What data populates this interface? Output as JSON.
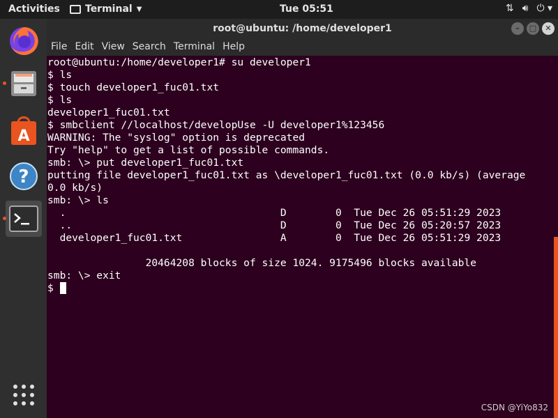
{
  "top_panel": {
    "activities": "Activities",
    "app_name": "Terminal",
    "clock": "Tue 05:51"
  },
  "window": {
    "title": "root@ubuntu: /home/developer1",
    "menu": [
      "File",
      "Edit",
      "View",
      "Search",
      "Terminal",
      "Help"
    ]
  },
  "terminal": {
    "lines": [
      "root@ubuntu:/home/developer1# su developer1",
      "$ ls",
      "$ touch developer1_fuc01.txt",
      "$ ls",
      "developer1_fuc01.txt",
      "$ smbclient //localhost/developUse -U developer1%123456",
      "WARNING: The \"syslog\" option is deprecated",
      "Try \"help\" to get a list of possible commands.",
      "smb: \\> put developer1_fuc01.txt",
      "putting file developer1_fuc01.txt as \\developer1_fuc01.txt (0.0 kb/s) (average",
      "0.0 kb/s)",
      "smb: \\> ls",
      "  .                                   D        0  Tue Dec 26 05:51:29 2023",
      "  ..                                  D        0  Tue Dec 26 05:20:57 2023",
      "  developer1_fuc01.txt                A        0  Tue Dec 26 05:51:29 2023",
      "",
      "                20464208 blocks of size 1024. 9175496 blocks available",
      "smb: \\> exit"
    ],
    "prompt": "$"
  },
  "watermark": "CSDN @YiYo832",
  "colors": {
    "terminal_bg": "#2c001e",
    "accent": "#e95420"
  }
}
